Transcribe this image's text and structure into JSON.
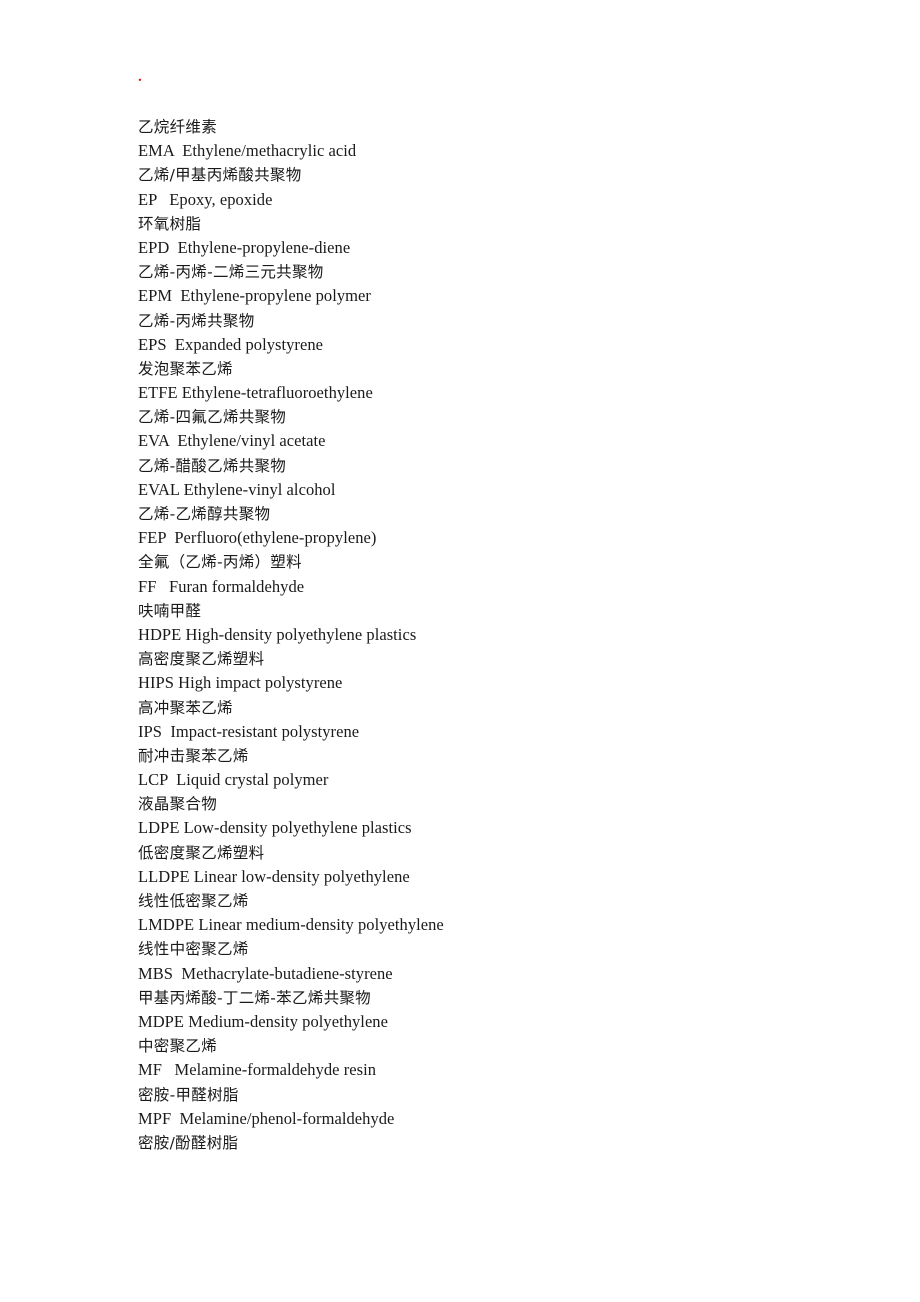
{
  "document": {
    "page_background": "#ffffff",
    "text_color": "#1a1a1a",
    "marker": {
      "glyph": ".",
      "color": "#ee1111"
    },
    "heading_orphan_zh": "乙烷纤维素",
    "entries": [
      {
        "en": "EMA  Ethylene/methacrylic acid",
        "zh": "乙烯/甲基丙烯酸共聚物"
      },
      {
        "en": "EP   Epoxy, epoxide",
        "zh": "环氧树脂"
      },
      {
        "en": "EPD  Ethylene-propylene-diene",
        "zh": "乙烯-丙烯-二烯三元共聚物"
      },
      {
        "en": "EPM  Ethylene-propylene polymer",
        "zh": "乙烯-丙烯共聚物"
      },
      {
        "en": "EPS  Expanded polystyrene",
        "zh": "发泡聚苯乙烯"
      },
      {
        "en": "ETFE Ethylene-tetrafluoroethylene",
        "zh": "乙烯-四氟乙烯共聚物"
      },
      {
        "en": "EVA  Ethylene/vinyl acetate",
        "zh": "乙烯-醋酸乙烯共聚物"
      },
      {
        "en": "EVAL Ethylene-vinyl alcohol",
        "zh": "乙烯-乙烯醇共聚物"
      },
      {
        "en": "FEP  Perfluoro(ethylene-propylene)",
        "zh": "全氟（乙烯-丙烯）塑料"
      },
      {
        "en": "FF   Furan formaldehyde",
        "zh": "呋喃甲醛"
      },
      {
        "en": "HDPE High-density polyethylene plastics",
        "zh": "高密度聚乙烯塑料"
      },
      {
        "en": "HIPS High impact polystyrene",
        "zh": "高冲聚苯乙烯"
      },
      {
        "en": "IPS  Impact-resistant polystyrene",
        "zh": "耐冲击聚苯乙烯"
      },
      {
        "en": "LCP  Liquid crystal polymer",
        "zh": "液晶聚合物"
      },
      {
        "en": "LDPE Low-density polyethylene plastics",
        "zh": "低密度聚乙烯塑料"
      },
      {
        "en": "LLDPE Linear low-density polyethylene",
        "zh": "线性低密聚乙烯"
      },
      {
        "en": "LMDPE Linear medium-density polyethylene",
        "zh": "线性中密聚乙烯"
      },
      {
        "en": "MBS  Methacrylate-butadiene-styrene",
        "zh": "甲基丙烯酸-丁二烯-苯乙烯共聚物"
      },
      {
        "en": "MDPE Medium-density polyethylene",
        "zh": "中密聚乙烯"
      },
      {
        "en": "MF   Melamine-formaldehyde resin",
        "zh": "密胺-甲醛树脂"
      },
      {
        "en": "MPF  Melamine/phenol-formaldehyde",
        "zh": "密胺/酚醛树脂"
      }
    ]
  }
}
